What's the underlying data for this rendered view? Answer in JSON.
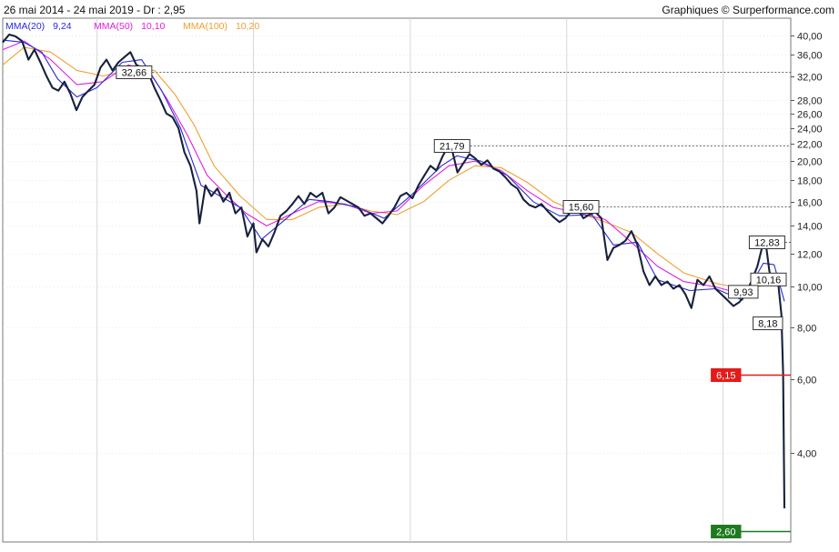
{
  "header": {
    "period": "26 mai 2014 - 24 mai 2019 - Dr : 2,95",
    "credit": "Graphiques © Surperformance.com"
  },
  "legend": [
    {
      "label": "MMA(20)",
      "value": "9,24",
      "color": "#2a2ad6"
    },
    {
      "label": "MMA(50)",
      "value": "10,10",
      "color": "#e020e0"
    },
    {
      "label": "MMA(100)",
      "value": "10,20",
      "color": "#f0a030"
    }
  ],
  "colors": {
    "price": "#17213d",
    "mma20": "#2a2ad6",
    "mma50": "#e020e0",
    "mma100": "#f0a030",
    "grid": "#d7d7d7",
    "red_line": "#e31b1b",
    "green_line": "#1f7a1f"
  },
  "chart_data": {
    "type": "line",
    "y_scale": "log",
    "ylim": [
      2.45,
      44
    ],
    "x_range": [
      "2014-05-26",
      "2019-05-24"
    ],
    "y_ticks": [
      "40,00",
      "36,00",
      "32,00",
      "28,00",
      "26,00",
      "24,00",
      "22,00",
      "20,00",
      "18,00",
      "16,00",
      "14,00",
      "12,00",
      "10,00",
      "8,00",
      "6,00",
      "4,00"
    ],
    "y_tick_values": [
      40,
      36,
      32,
      28,
      26,
      24,
      22,
      20,
      18,
      16,
      14,
      12,
      10,
      8,
      6,
      4
    ],
    "x_gridlines": [
      "2015-01-01",
      "2016-01-01",
      "2017-01-01",
      "2018-01-01",
      "2019-01-01"
    ],
    "series": [
      {
        "name": "Cours",
        "points": [
          [
            "2014-05-26",
            38.5
          ],
          [
            "2014-06-10",
            40.2
          ],
          [
            "2014-06-25",
            39.8
          ],
          [
            "2014-07-10",
            38.8
          ],
          [
            "2014-07-25",
            35.0
          ],
          [
            "2014-08-08",
            37.0
          ],
          [
            "2014-08-22",
            34.5
          ],
          [
            "2014-09-05",
            32.0
          ],
          [
            "2014-09-19",
            30.0
          ],
          [
            "2014-10-03",
            29.5
          ],
          [
            "2014-10-17",
            31.0
          ],
          [
            "2014-10-31",
            29.0
          ],
          [
            "2014-11-14",
            26.5
          ],
          [
            "2014-11-28",
            28.5
          ],
          [
            "2014-12-12",
            29.5
          ],
          [
            "2014-12-26",
            30.5
          ],
          [
            "2015-01-09",
            33.5
          ],
          [
            "2015-01-23",
            35.0
          ],
          [
            "2015-02-06",
            33.0
          ],
          [
            "2015-02-20",
            34.5
          ],
          [
            "2015-03-06",
            35.5
          ],
          [
            "2015-03-20",
            36.5
          ],
          [
            "2015-04-03",
            34.0
          ],
          [
            "2015-04-17",
            33.5
          ],
          [
            "2015-05-01",
            32.5
          ],
          [
            "2015-05-15",
            30.0
          ],
          [
            "2015-05-29",
            28.0
          ],
          [
            "2015-06-12",
            26.0
          ],
          [
            "2015-06-26",
            25.5
          ],
          [
            "2015-07-10",
            24.0
          ],
          [
            "2015-07-24",
            21.0
          ],
          [
            "2015-08-07",
            19.5
          ],
          [
            "2015-08-21",
            17.0
          ],
          [
            "2015-08-28",
            14.2
          ],
          [
            "2015-09-11",
            17.5
          ],
          [
            "2015-09-25",
            16.5
          ],
          [
            "2015-10-09",
            17.2
          ],
          [
            "2015-10-23",
            16.0
          ],
          [
            "2015-11-06",
            16.8
          ],
          [
            "2015-11-20",
            15.0
          ],
          [
            "2015-12-04",
            15.5
          ],
          [
            "2015-12-18",
            13.2
          ],
          [
            "2016-01-01",
            14.2
          ],
          [
            "2016-01-08",
            12.1
          ],
          [
            "2016-01-22",
            13.0
          ],
          [
            "2016-02-05",
            12.5
          ],
          [
            "2016-02-19",
            13.5
          ],
          [
            "2016-03-04",
            14.8
          ],
          [
            "2016-03-18",
            15.2
          ],
          [
            "2016-04-01",
            15.8
          ],
          [
            "2016-04-15",
            16.5
          ],
          [
            "2016-04-29",
            15.8
          ],
          [
            "2016-05-13",
            16.8
          ],
          [
            "2016-05-27",
            16.4
          ],
          [
            "2016-06-10",
            16.8
          ],
          [
            "2016-06-24",
            15.0
          ],
          [
            "2016-07-08",
            15.5
          ],
          [
            "2016-07-22",
            16.4
          ],
          [
            "2016-08-05",
            16.1
          ],
          [
            "2016-08-19",
            15.8
          ],
          [
            "2016-09-02",
            15.5
          ],
          [
            "2016-09-16",
            14.8
          ],
          [
            "2016-09-30",
            15.0
          ],
          [
            "2016-10-14",
            14.6
          ],
          [
            "2016-10-28",
            14.2
          ],
          [
            "2016-11-11",
            14.8
          ],
          [
            "2016-11-25",
            15.5
          ],
          [
            "2016-12-09",
            16.5
          ],
          [
            "2016-12-23",
            16.8
          ],
          [
            "2017-01-06",
            16.3
          ],
          [
            "2017-01-20",
            17.5
          ],
          [
            "2017-02-03",
            18.5
          ],
          [
            "2017-02-17",
            19.5
          ],
          [
            "2017-03-03",
            19.0
          ],
          [
            "2017-03-17",
            20.5
          ],
          [
            "2017-03-31",
            21.8
          ],
          [
            "2017-04-07",
            21.6
          ],
          [
            "2017-04-21",
            18.8
          ],
          [
            "2017-05-05",
            19.8
          ],
          [
            "2017-05-19",
            20.8
          ],
          [
            "2017-06-02",
            20.3
          ],
          [
            "2017-06-16",
            19.6
          ],
          [
            "2017-06-30",
            20.1
          ],
          [
            "2017-07-14",
            19.2
          ],
          [
            "2017-07-28",
            18.9
          ],
          [
            "2017-08-11",
            18.3
          ],
          [
            "2017-08-25",
            17.6
          ],
          [
            "2017-09-08",
            17.2
          ],
          [
            "2017-09-22",
            16.2
          ],
          [
            "2017-10-06",
            15.7
          ],
          [
            "2017-10-20",
            15.5
          ],
          [
            "2017-11-03",
            15.8
          ],
          [
            "2017-11-17",
            15.2
          ],
          [
            "2017-12-01",
            14.7
          ],
          [
            "2017-12-15",
            14.3
          ],
          [
            "2017-12-29",
            14.6
          ],
          [
            "2018-01-12",
            15.2
          ],
          [
            "2018-01-26",
            15.4
          ],
          [
            "2018-02-09",
            14.6
          ],
          [
            "2018-02-23",
            14.9
          ],
          [
            "2018-03-09",
            15.1
          ],
          [
            "2018-03-23",
            14.6
          ],
          [
            "2018-04-06",
            11.6
          ],
          [
            "2018-04-20",
            12.4
          ],
          [
            "2018-05-04",
            12.6
          ],
          [
            "2018-05-18",
            12.9
          ],
          [
            "2018-06-01",
            13.6
          ],
          [
            "2018-06-15",
            12.6
          ],
          [
            "2018-06-29",
            10.9
          ],
          [
            "2018-07-13",
            10.1
          ],
          [
            "2018-07-27",
            10.6
          ],
          [
            "2018-08-10",
            10.1
          ],
          [
            "2018-08-24",
            10.3
          ],
          [
            "2018-09-07",
            9.9
          ],
          [
            "2018-09-21",
            10.1
          ],
          [
            "2018-10-05",
            9.6
          ],
          [
            "2018-10-19",
            8.9
          ],
          [
            "2018-11-02",
            10.4
          ],
          [
            "2018-11-16",
            10.1
          ],
          [
            "2018-11-30",
            10.6
          ],
          [
            "2018-12-14",
            9.9
          ],
          [
            "2018-12-28",
            9.6
          ],
          [
            "2019-01-11",
            9.3
          ],
          [
            "2019-01-25",
            9.0
          ],
          [
            "2019-02-08",
            9.2
          ],
          [
            "2019-02-22",
            9.6
          ],
          [
            "2019-03-08",
            10.3
          ],
          [
            "2019-03-22",
            11.2
          ],
          [
            "2019-04-05",
            12.8
          ],
          [
            "2019-04-12",
            12.4
          ],
          [
            "2019-04-19",
            10.9
          ],
          [
            "2019-04-26",
            10.4
          ],
          [
            "2019-05-03",
            10.5
          ],
          [
            "2019-05-10",
            10.1
          ],
          [
            "2019-05-17",
            8.6
          ],
          [
            "2019-05-21",
            6.2
          ],
          [
            "2019-05-24",
            2.95
          ]
        ]
      },
      {
        "name": "MMA(20)",
        "points": [
          [
            "2014-05-26",
            39.0
          ],
          [
            "2014-07-15",
            38.5
          ],
          [
            "2014-08-25",
            36.5
          ],
          [
            "2014-10-01",
            31.5
          ],
          [
            "2014-11-15",
            28.5
          ],
          [
            "2015-01-01",
            30.0
          ],
          [
            "2015-03-01",
            34.5
          ],
          [
            "2015-04-15",
            35.0
          ],
          [
            "2015-06-01",
            29.5
          ],
          [
            "2015-07-15",
            24.0
          ],
          [
            "2015-09-01",
            17.5
          ],
          [
            "2015-10-15",
            16.5
          ],
          [
            "2015-12-01",
            15.5
          ],
          [
            "2016-01-20",
            13.0
          ],
          [
            "2016-03-15",
            14.5
          ],
          [
            "2016-05-10",
            16.2
          ],
          [
            "2016-07-01",
            16.0
          ],
          [
            "2016-09-01",
            15.5
          ],
          [
            "2016-11-01",
            14.6
          ],
          [
            "2017-01-01",
            16.5
          ],
          [
            "2017-03-15",
            19.5
          ],
          [
            "2017-04-20",
            20.6
          ],
          [
            "2017-06-15",
            20.0
          ],
          [
            "2017-08-15",
            18.5
          ],
          [
            "2017-10-15",
            16.0
          ],
          [
            "2017-12-15",
            14.8
          ],
          [
            "2018-03-01",
            14.9
          ],
          [
            "2018-04-20",
            12.6
          ],
          [
            "2018-06-15",
            12.8
          ],
          [
            "2018-08-01",
            10.4
          ],
          [
            "2018-10-15",
            9.8
          ],
          [
            "2018-12-15",
            9.9
          ],
          [
            "2019-02-15",
            9.3
          ],
          [
            "2019-04-05",
            11.4
          ],
          [
            "2019-04-30",
            11.3
          ],
          [
            "2019-05-24",
            9.24
          ]
        ]
      },
      {
        "name": "MMA(50)",
        "points": [
          [
            "2014-05-26",
            37.0
          ],
          [
            "2014-07-15",
            38.8
          ],
          [
            "2014-09-15",
            35.0
          ],
          [
            "2014-11-15",
            30.5
          ],
          [
            "2015-01-15",
            31.0
          ],
          [
            "2015-03-15",
            34.0
          ],
          [
            "2015-05-01",
            33.0
          ],
          [
            "2015-06-15",
            28.0
          ],
          [
            "2015-08-01",
            23.0
          ],
          [
            "2015-09-15",
            18.5
          ],
          [
            "2015-11-01",
            16.5
          ],
          [
            "2015-12-15",
            15.0
          ],
          [
            "2016-02-01",
            14.0
          ],
          [
            "2016-04-01",
            15.0
          ],
          [
            "2016-06-01",
            16.0
          ],
          [
            "2016-08-01",
            15.8
          ],
          [
            "2016-10-01",
            15.0
          ],
          [
            "2016-12-01",
            15.2
          ],
          [
            "2017-02-01",
            17.5
          ],
          [
            "2017-04-01",
            19.5
          ],
          [
            "2017-06-01",
            20.0
          ],
          [
            "2017-08-01",
            19.0
          ],
          [
            "2017-10-01",
            17.0
          ],
          [
            "2017-12-01",
            15.5
          ],
          [
            "2018-02-01",
            15.0
          ],
          [
            "2018-04-01",
            14.5
          ],
          [
            "2018-06-01",
            12.8
          ],
          [
            "2018-08-01",
            11.2
          ],
          [
            "2018-10-01",
            10.3
          ],
          [
            "2018-12-15",
            10.0
          ],
          [
            "2019-02-15",
            9.6
          ],
          [
            "2019-04-01",
            10.4
          ],
          [
            "2019-05-24",
            10.1
          ]
        ]
      },
      {
        "name": "MMA(100)",
        "points": [
          [
            "2014-05-26",
            34.0
          ],
          [
            "2014-07-15",
            37.5
          ],
          [
            "2014-09-15",
            36.5
          ],
          [
            "2014-11-15",
            33.0
          ],
          [
            "2015-01-15",
            32.0
          ],
          [
            "2015-03-15",
            33.0
          ],
          [
            "2015-05-15",
            33.0
          ],
          [
            "2015-07-01",
            29.0
          ],
          [
            "2015-08-15",
            24.5
          ],
          [
            "2015-10-01",
            19.5
          ],
          [
            "2015-12-01",
            16.5
          ],
          [
            "2016-02-01",
            14.5
          ],
          [
            "2016-04-01",
            14.5
          ],
          [
            "2016-06-01",
            15.5
          ],
          [
            "2016-08-01",
            15.8
          ],
          [
            "2016-10-01",
            15.2
          ],
          [
            "2016-12-01",
            14.9
          ],
          [
            "2017-02-01",
            16.0
          ],
          [
            "2017-04-01",
            18.0
          ],
          [
            "2017-06-01",
            19.5
          ],
          [
            "2017-08-01",
            19.3
          ],
          [
            "2017-10-01",
            17.8
          ],
          [
            "2017-12-01",
            16.0
          ],
          [
            "2018-02-01",
            15.0
          ],
          [
            "2018-04-01",
            14.3
          ],
          [
            "2018-06-01",
            13.5
          ],
          [
            "2018-08-01",
            12.0
          ],
          [
            "2018-10-01",
            10.8
          ],
          [
            "2018-12-15",
            10.2
          ],
          [
            "2019-02-15",
            9.9
          ],
          [
            "2019-04-15",
            10.1
          ],
          [
            "2019-05-24",
            10.2
          ]
        ]
      }
    ],
    "reference_lines": [
      {
        "label": "32,66",
        "value": 32.66,
        "from": "2015-03-20",
        "style": "dashed"
      },
      {
        "label": "21,79",
        "value": 21.79,
        "from": "2017-03-31",
        "style": "dashed"
      },
      {
        "label": "15,60",
        "value": 15.6,
        "from": "2018-01-26",
        "style": "dashed"
      },
      {
        "label": "12,83",
        "value": 12.83,
        "from": "2019-04-05",
        "style": "dashed"
      }
    ],
    "price_labels": [
      {
        "label": "10,16",
        "value": 10.16
      },
      {
        "label": "9,93",
        "value": 9.93
      },
      {
        "label": "8,18",
        "value": 8.18
      }
    ],
    "levels": [
      {
        "label": "6,15",
        "value": 6.15,
        "color": "red"
      },
      {
        "label": "2,60",
        "value": 2.6,
        "color": "green"
      }
    ]
  }
}
